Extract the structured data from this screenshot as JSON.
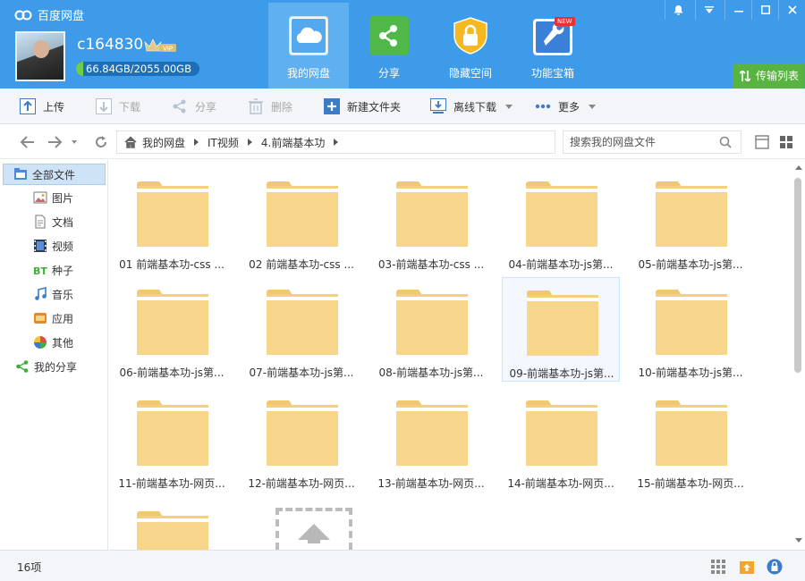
{
  "app": {
    "title": "百度网盘"
  },
  "user": {
    "name": "c164830",
    "storage_text": "66.84GB/2055.00GB",
    "storage_used_fraction": 0.0325,
    "vip_badge": "VIP"
  },
  "nav_tabs": [
    {
      "label": "我的网盘",
      "icon": "cloud-icon",
      "active": true
    },
    {
      "label": "分享",
      "icon": "share-icon",
      "active": false
    },
    {
      "label": "隐藏空间",
      "icon": "lock-icon",
      "active": false
    },
    {
      "label": "功能宝箱",
      "icon": "wrench-icon",
      "badge": "NEW",
      "active": false
    }
  ],
  "transfer_list": "传输列表",
  "toolbar": {
    "upload": "上传",
    "download": "下载",
    "share": "分享",
    "delete": "删除",
    "new_folder": "新建文件夹",
    "offline_download": "离线下载",
    "more": "更多"
  },
  "breadcrumb": [
    "我的网盘",
    "IT视频",
    "4.前端基本功"
  ],
  "search": {
    "placeholder": "搜索我的网盘文件"
  },
  "sidebar": {
    "all_files": "全部文件",
    "items": [
      "图片",
      "文档",
      "视频",
      "种子",
      "音乐",
      "应用",
      "其他"
    ],
    "my_share": "我的分享"
  },
  "folders": [
    "01 前端基本功-css ...",
    "02 前端基本功-css ...",
    "03-前端基本功-css ...",
    "04-前端基本功-js第...",
    "05-前端基本功-js第...",
    "06-前端基本功-js第...",
    "07-前端基本功-js第...",
    "08-前端基本功-js第...",
    "09-前端基本功-js第...",
    "10-前端基本功-js第...",
    "11-前端基本功-网页...",
    "12-前端基本功-网页...",
    "13-前端基本功-网页...",
    "14-前端基本功-网页...",
    "15-前端基本功-网页...",
    ""
  ],
  "selected_folder_index": 8,
  "status": {
    "count": "16项"
  },
  "colors": {
    "header": "#3d9be9",
    "active_tab": "#5eb0f1",
    "folder": "#f7d58b",
    "transfer_button": "#58b441"
  }
}
